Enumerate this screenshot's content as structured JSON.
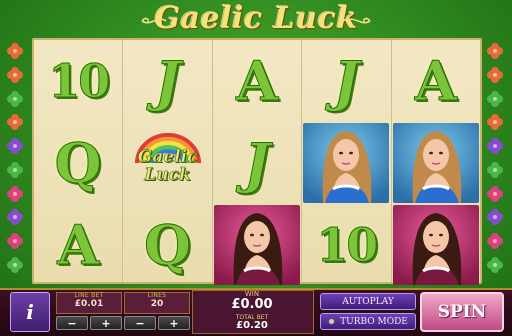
{
  "game": {
    "title": "Gaelic Luck"
  },
  "reels": [
    [
      "10",
      "Q",
      "A"
    ],
    [
      "J",
      "Gaelic Luck",
      "Q"
    ],
    [
      "A",
      "J",
      "woman-pink"
    ],
    [
      "J",
      "woman-blue",
      "10"
    ],
    [
      "A",
      "woman-blue",
      "woman-pink"
    ]
  ],
  "controls": {
    "info_label": "i",
    "line_bet": {
      "label": "LINE BET",
      "value": "£0.01"
    },
    "lines": {
      "label": "LINES",
      "value": "20"
    },
    "minus": "−",
    "plus": "+",
    "win": {
      "label": "WIN",
      "value": "£0.00"
    },
    "total_bet": {
      "label": "TOTAL BET",
      "value": "£0.20"
    },
    "autoplay_label": "AUTOPLAY",
    "turbo_label": "TURBO MODE",
    "spin_label": "SPIN"
  },
  "colors": {
    "background": "#2f8a1f",
    "reel_bg": "#f3e8c4",
    "symbol_green": "#7cc43a",
    "spin_pink": "#c04a86",
    "button_purple": "#6f3fb8"
  }
}
